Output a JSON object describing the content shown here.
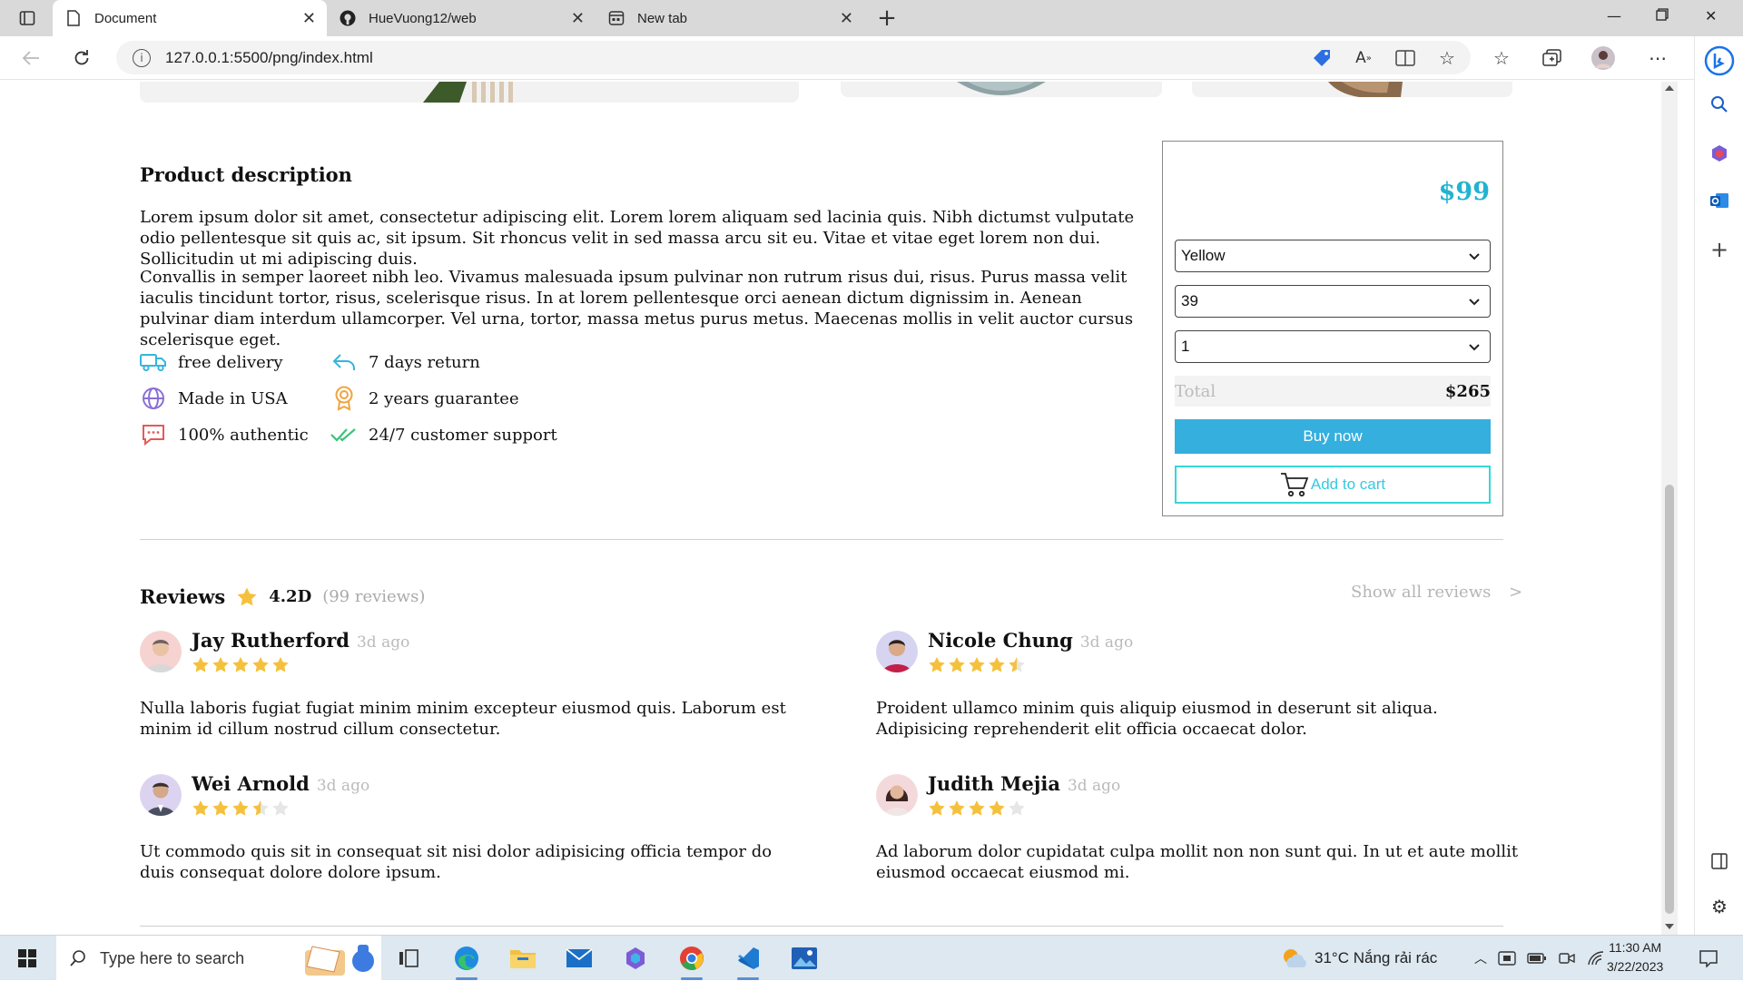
{
  "browser": {
    "tabs": [
      {
        "label": "Document",
        "icon": "document-icon",
        "active": true
      },
      {
        "label": "HueVuong12/web",
        "icon": "github-icon",
        "active": false
      },
      {
        "label": "New tab",
        "icon": "newtab-icon",
        "active": false
      }
    ],
    "url": "127.0.0.1:5500/png/index.html"
  },
  "product": {
    "description_title": "Product description",
    "paragraphs": [
      "Lorem ipsum dolor sit amet, consectetur adipiscing elit. Lorem lorem aliquam sed lacinia quis. Nibh dictumst vulputate odio pellentesque sit quis ac, sit ipsum. Sit rhoncus velit in sed massa arcu sit eu. Vitae et vitae eget lorem non dui. Sollicitudin ut mi adipiscing duis.",
      "Convallis in semper laoreet nibh leo. Vivamus malesuada ipsum pulvinar non rutrum risus dui, risus. Purus massa velit iaculis tincidunt tortor, risus, scelerisque risus. In at lorem pellentesque orci aenean dictum dignissim in. Aenean pulvinar diam interdum ullamcorper. Vel urna, tortor, massa metus purus metus. Maecenas mollis in velit auctor cursus scelerisque eget."
    ],
    "features": [
      {
        "label": "free delivery",
        "icon": "truck-icon",
        "color": "#35b5de"
      },
      {
        "label": "7 days return",
        "icon": "return-arrow-icon",
        "color": "#35b5de"
      },
      {
        "label": "Made in USA",
        "icon": "globe-icon",
        "color": "#8a6fd6"
      },
      {
        "label": "2 years guarantee",
        "icon": "award-icon",
        "color": "#f0a440"
      },
      {
        "label": "100% authentic",
        "icon": "chat-icon",
        "color": "#e45a5a"
      },
      {
        "label": "24/7 customer support",
        "icon": "double-check-icon",
        "color": "#3cc27a"
      }
    ]
  },
  "buybox": {
    "price": "$99",
    "color_value": "Yellow",
    "size_value": "39",
    "qty_value": "1",
    "total_label": "Total",
    "total_value": "$265",
    "buy_label": "Buy now",
    "cart_label": "Add to cart"
  },
  "reviews": {
    "title": "Reviews",
    "score": "4.2D",
    "count": "(99 reviews)",
    "show_all": "Show all reviews",
    "show_all_arrow": ">",
    "items": [
      {
        "name": "Jay Rutherford",
        "ago": "3d ago",
        "rating": 5,
        "text": "Nulla laboris fugiat fugiat minim minim excepteur eiusmod quis. Laborum est minim id cillum nostrud cillum consectetur."
      },
      {
        "name": "Nicole Chung",
        "ago": "3d ago",
        "rating": 4.5,
        "text": "Proident ullamco minim quis aliquip eiusmod in deserunt sit aliqua. Adipisicing reprehenderit elit officia occaecat dolor."
      },
      {
        "name": "Wei Arnold",
        "ago": "3d ago",
        "rating": 3.5,
        "text": "Ut commodo quis sit in consequat sit nisi dolor adipisicing officia tempor do duis consequat dolore dolore ipsum."
      },
      {
        "name": "Judith Mejia",
        "ago": "3d ago",
        "rating": 4,
        "text": "Ad laborum dolor cupidatat culpa mollit non non sunt qui. In ut et aute mollit eiusmod occaecat eiusmod mi."
      }
    ],
    "star_color": "#f5c13d"
  },
  "taskbar": {
    "search_placeholder": "Type here to search",
    "weather": "31°C  Nắng rải rác",
    "time": "11:30 AM",
    "date": "3/22/2023"
  }
}
